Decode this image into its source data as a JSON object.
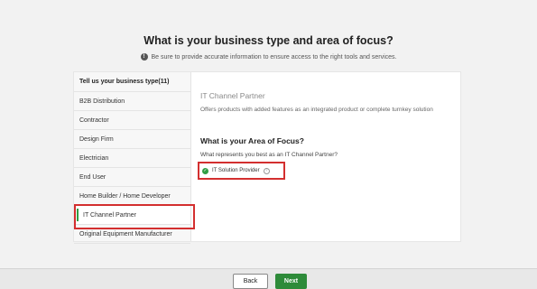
{
  "header": {
    "title": "What is your business type and area of focus?",
    "subtitle": "Be sure to provide accurate information to ensure access to the right tools and services."
  },
  "sidebar": {
    "header": "Tell us your business type(11)",
    "items": [
      {
        "label": "B2B Distribution"
      },
      {
        "label": "Contractor"
      },
      {
        "label": "Design Firm"
      },
      {
        "label": "Electrician"
      },
      {
        "label": "End User"
      },
      {
        "label": "Home Builder / Home Developer"
      },
      {
        "label": "IT Channel Partner",
        "selected": true
      },
      {
        "label": "Original Equipment Manufacturer"
      }
    ]
  },
  "content": {
    "title": "IT Channel Partner",
    "description": "Offers products with added features as an integrated product or complete turnkey solution",
    "focus_heading": "What is your Area of Focus?",
    "question": "What represents you best as an IT Channel Partner?",
    "option_label": "IT Solution Provider"
  },
  "footer": {
    "back_label": "Back",
    "next_label": "Next"
  },
  "colors": {
    "accent_green": "#2e8b3a",
    "highlight_red": "#d32f2f"
  },
  "icons": [
    "info-icon",
    "check-icon",
    "help-icon"
  ]
}
